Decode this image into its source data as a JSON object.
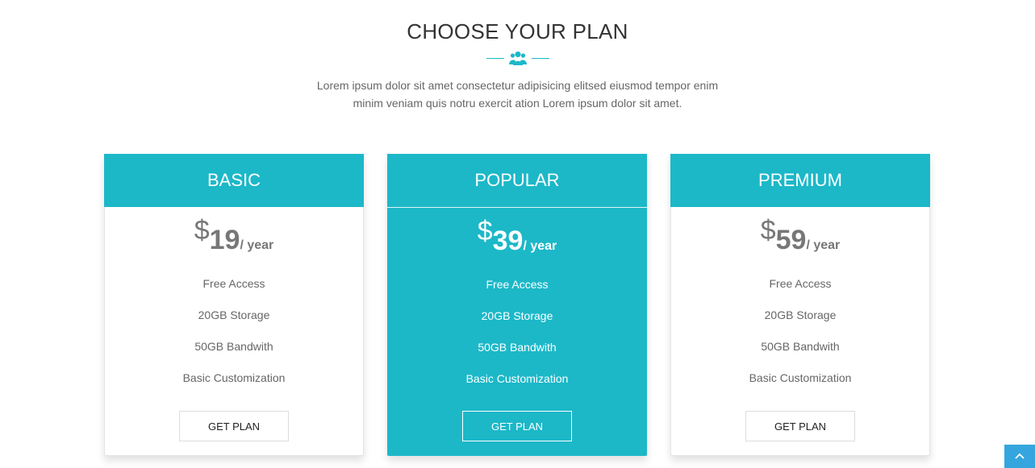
{
  "header": {
    "title": "CHOOSE YOUR PLAN",
    "subtitle_line1": "Lorem ipsum dolor sit amet consectetur adipisicing elitsed eiusmod tempor enim",
    "subtitle_line2": "minim veniam quis notru exercit ation Lorem ipsum dolor sit amet.",
    "divider_icon": "users-icon"
  },
  "colors": {
    "accent": "#1cb8c8",
    "scroll_button": "#35a6dd"
  },
  "plans": [
    {
      "name": "BASIC",
      "currency": "$",
      "amount": "19",
      "period": "/ year",
      "features": [
        "Free Access",
        "20GB Storage",
        "50GB Bandwith",
        "Basic Customization"
      ],
      "button": "GET PLAN"
    },
    {
      "name": "POPULAR",
      "currency": "$",
      "amount": "39",
      "period": "/ year",
      "features": [
        "Free Access",
        "20GB Storage",
        "50GB Bandwith",
        "Basic Customization"
      ],
      "button": "GET PLAN"
    },
    {
      "name": "PREMIUM",
      "currency": "$",
      "amount": "59",
      "period": "/ year",
      "features": [
        "Free Access",
        "20GB Storage",
        "50GB Bandwith",
        "Basic Customization"
      ],
      "button": "GET PLAN"
    }
  ],
  "scroll_top_icon": "chevron-up-icon"
}
